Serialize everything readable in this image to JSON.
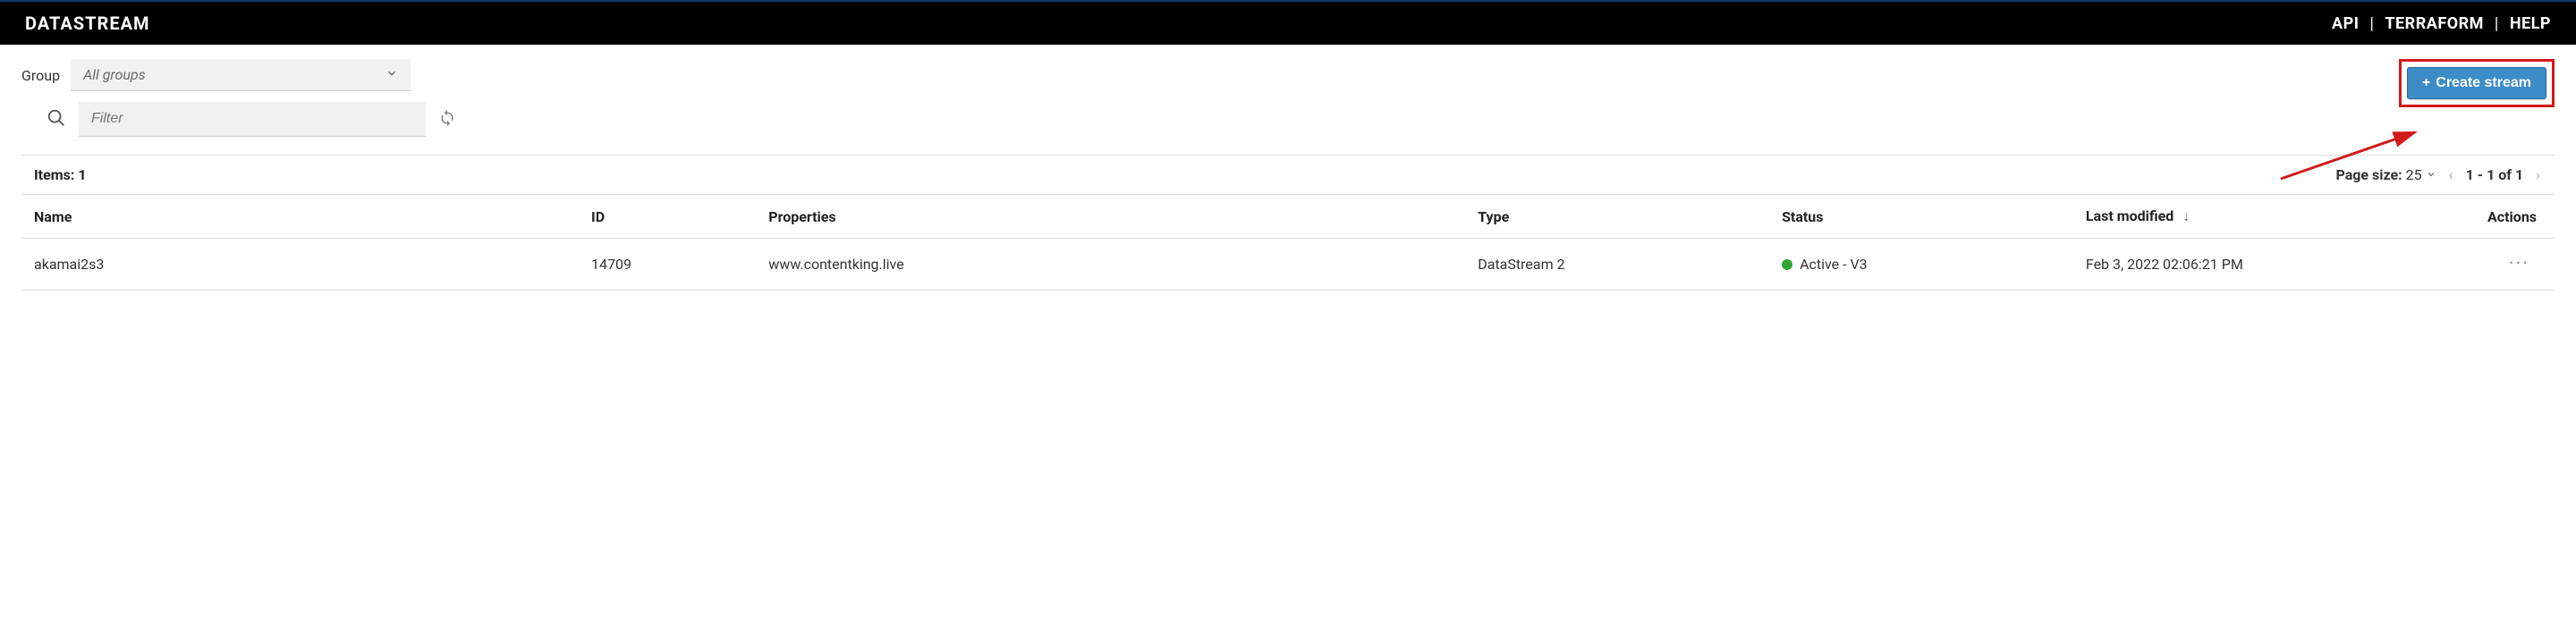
{
  "header": {
    "title": "DATASTREAM",
    "links": {
      "api": "API",
      "terraform": "TERRAFORM",
      "help": "HELP"
    }
  },
  "toolbar": {
    "group_label": "Group",
    "group_value": "All groups",
    "filter_placeholder": "Filter",
    "create_label": "Create stream"
  },
  "table": {
    "items_label": "Items:",
    "items_count": "1",
    "page_size_label": "Page size:",
    "page_size_value": "25",
    "range_text": "1 - 1 of 1",
    "columns": {
      "name": "Name",
      "id": "ID",
      "properties": "Properties",
      "type": "Type",
      "status": "Status",
      "last_modified": "Last modified",
      "actions": "Actions"
    },
    "rows": [
      {
        "name": "akamai2s3",
        "id": "14709",
        "properties": "www.contentking.live",
        "type": "DataStream 2",
        "status": "Active - V3",
        "status_color": "#2fa52f",
        "last_modified": "Feb 3, 2022 02:06:21 PM"
      }
    ]
  }
}
